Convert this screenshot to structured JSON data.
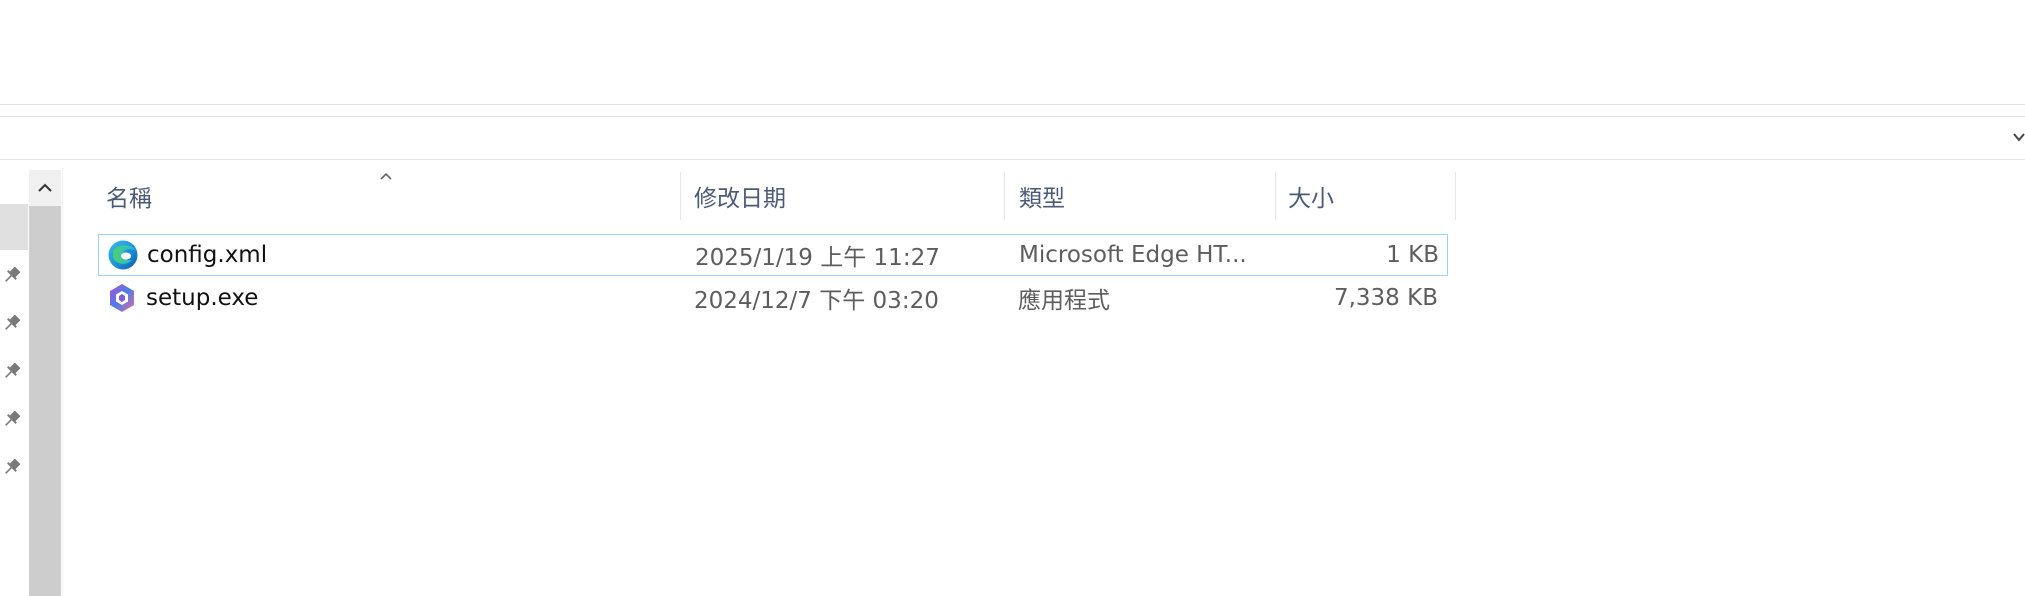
{
  "columns": {
    "name": "名稱",
    "modified": "修改日期",
    "type": "類型",
    "size": "大小"
  },
  "files": [
    {
      "name": "config.xml",
      "modified": "2025/1/19 上午 11:27",
      "type": "Microsoft Edge HT...",
      "size": "1 KB",
      "icon": "edge-icon",
      "selected": true
    },
    {
      "name": "setup.exe",
      "modified": "2024/12/7 下午 03:20",
      "type": "應用程式",
      "size": "7,338 KB",
      "icon": "office-setup-icon",
      "selected": false
    }
  ],
  "colors": {
    "header_text": "#4a5a78",
    "selection_border": "#99d1ff",
    "scrollbar_thumb": "#cdcdcd"
  }
}
